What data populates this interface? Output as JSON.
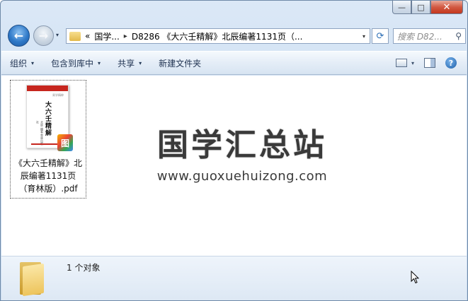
{
  "window": {
    "minimize_glyph": "—",
    "maximize_glyph": "□",
    "close_glyph": "✕"
  },
  "nav": {
    "back_glyph": "←",
    "forward_glyph": "→",
    "history_glyph": "▾"
  },
  "address": {
    "overflow": "«",
    "crumb_root": "国学...",
    "crumb_sep": "▸",
    "crumb_current": "D8286 《大六壬精解》北辰编著1131页（...",
    "dropdown_glyph": "▾"
  },
  "refresh_glyph": "⟳",
  "search": {
    "placeholder": "搜索 D82...",
    "icon_glyph": "⚲"
  },
  "toolbar": {
    "organize": "组织",
    "include_library": "包含到库中",
    "share": "共享",
    "new_folder": "新建文件夹",
    "arrow_glyph": "▾",
    "help_glyph": "?"
  },
  "file": {
    "name": "《大六壬精解》北辰编著1131页（育林版）.pdf",
    "thumbnail": {
      "series": "易学精粹",
      "title": "大六壬精解",
      "subtitle": "北辰 编著 育林出版社",
      "badge_glyph": "图"
    }
  },
  "watermark": {
    "title": "国学汇总站",
    "url": "www.guoxuehuizong.com"
  },
  "status": {
    "count_text": "1 个对象"
  }
}
